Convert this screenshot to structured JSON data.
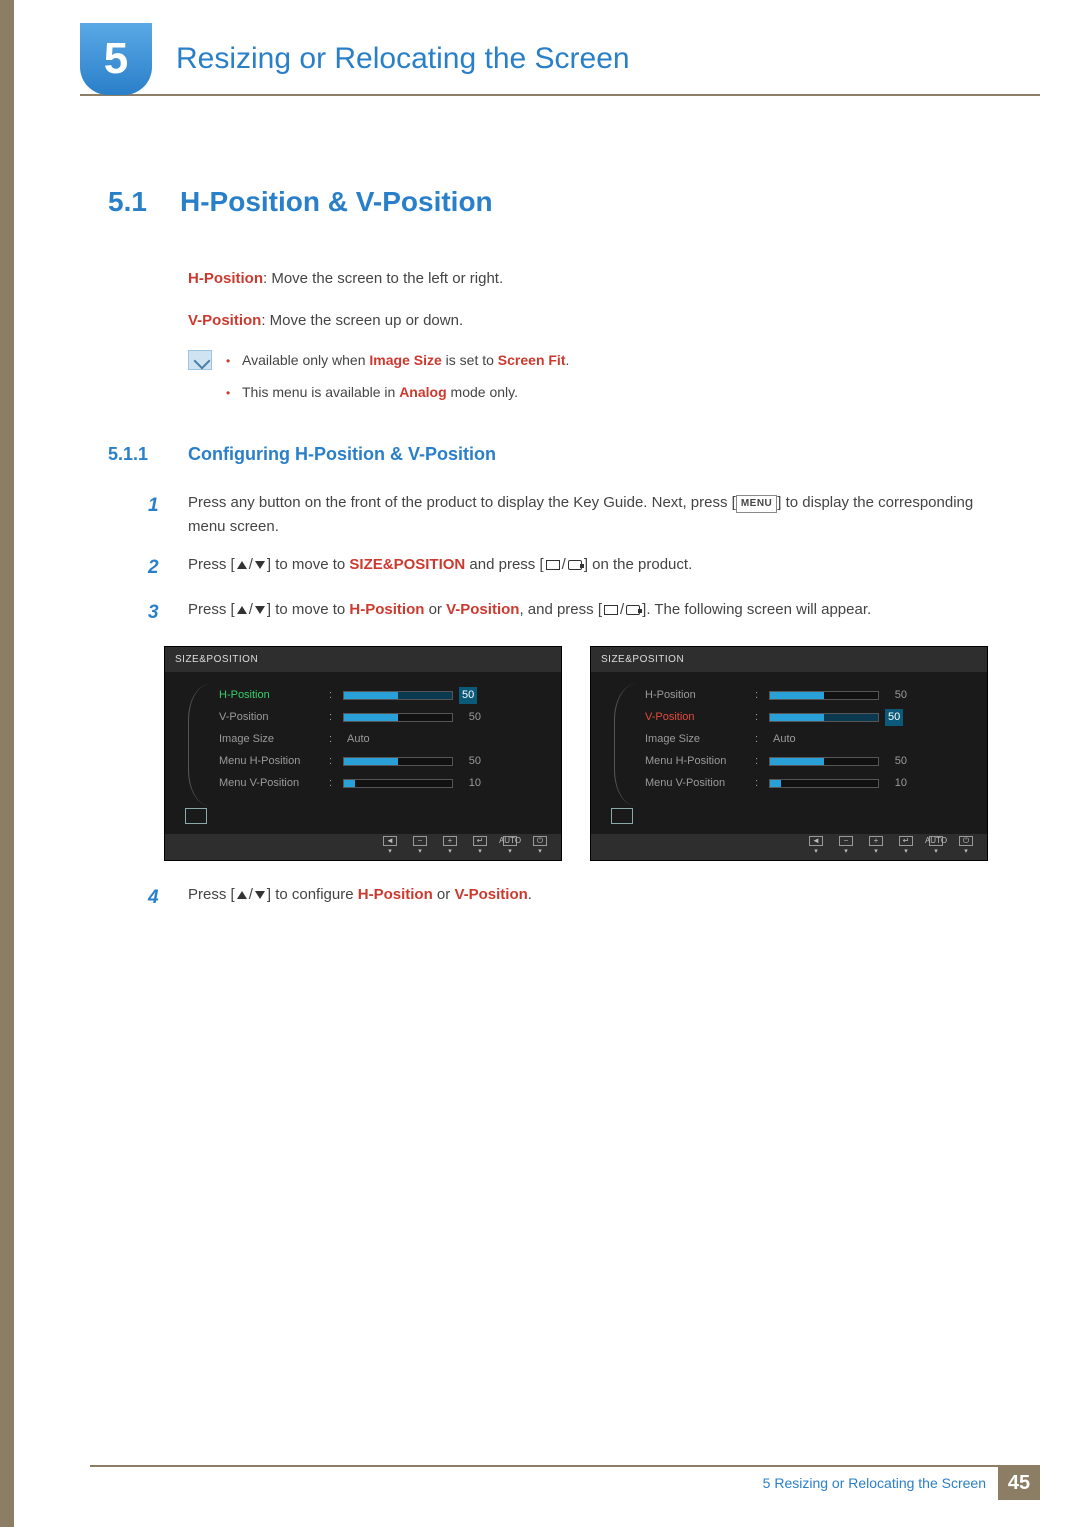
{
  "chapter": {
    "number": "5",
    "title": "Resizing or Relocating the Screen"
  },
  "section": {
    "number": "5.1",
    "title": "H-Position & V-Position"
  },
  "defs": {
    "h_label": "H-Position",
    "h_text": ": Move the screen to the left or right.",
    "v_label": "V-Position",
    "v_text": ": Move the screen up or down."
  },
  "note": {
    "line1a": "Available only when ",
    "line1b": "Image Size",
    "line1c": " is set to ",
    "line1d": "Screen Fit",
    "line1e": ".",
    "line2a": "This menu is available in ",
    "line2b": "Analog",
    "line2c": " mode only."
  },
  "subsection": {
    "number": "5.1.1",
    "title": "Configuring H-Position & V-Position"
  },
  "steps": {
    "s1a": "Press any button on the front of the product to display the Key Guide. Next, press [",
    "s1menu": "MENU",
    "s1b": "] to display the corresponding menu screen.",
    "s2a": "Press [",
    "s2b": "] to move to ",
    "s2target": "SIZE&POSITION",
    "s2c": " and press [",
    "s2d": "] on the product.",
    "s3a": "Press [",
    "s3b": "] to move to ",
    "s3h": "H-Position",
    "s3or": " or ",
    "s3v": "V-Position",
    "s3c": ", and press [",
    "s3d": "]. The following screen will appear.",
    "s4a": "Press [",
    "s4b": "] to configure ",
    "s4h": "H-Position",
    "s4or": " or ",
    "s4v": "V-Position",
    "s4c": "."
  },
  "osd": {
    "title": "SIZE&POSITION",
    "rows": [
      {
        "label": "H-Position",
        "value": "50",
        "fill": 50,
        "type": "slider"
      },
      {
        "label": "V-Position",
        "value": "50",
        "fill": 50,
        "type": "slider"
      },
      {
        "label": "Image Size",
        "value": "Auto",
        "type": "text"
      },
      {
        "label": "Menu H-Position",
        "value": "50",
        "fill": 50,
        "type": "slider"
      },
      {
        "label": "Menu V-Position",
        "value": "10",
        "fill": 10,
        "type": "slider"
      }
    ],
    "footer": [
      "◄",
      "−",
      "+",
      "↵",
      "AUTO",
      "⏻"
    ],
    "footer_sub": "▾"
  },
  "footer": {
    "text": "5 Resizing or Relocating the Screen",
    "page": "45"
  }
}
